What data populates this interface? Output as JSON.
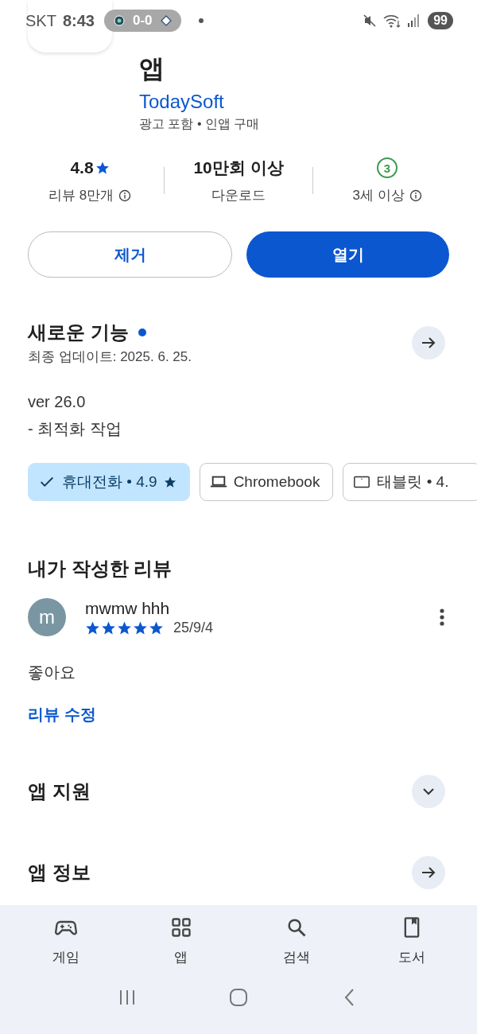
{
  "status_bar": {
    "carrier": "SKT",
    "time": "8:43",
    "score": "0-0",
    "battery": "99"
  },
  "app": {
    "title_line": "앱",
    "developer": "TodaySoft",
    "notes": "광고 포함 • 인앱 구매"
  },
  "stats": [
    {
      "kind": "rating",
      "value": "4.8",
      "label": "리뷰 8만개",
      "info": true
    },
    {
      "kind": "text",
      "value": "10만회 이상",
      "label": "다운로드",
      "info": false
    },
    {
      "kind": "age",
      "value": "3",
      "label": "3세 이상",
      "info": true
    }
  ],
  "actions": [
    {
      "label": "제거",
      "kind": "outline"
    },
    {
      "label": "열기",
      "kind": "filled"
    }
  ],
  "whats_new": {
    "title": "새로운 기능",
    "new_dot": true,
    "updated": "최종 업데이트: 2025. 6. 25.",
    "lines": [
      "ver 26.0",
      "- 최적화 작업"
    ]
  },
  "devices": [
    {
      "label": "휴대전화 • 4.9",
      "star": true,
      "selected": true
    },
    {
      "label": "Chromebook",
      "kind": "chromebook",
      "star": false,
      "selected": false
    },
    {
      "label": "태블릿 • 4.",
      "kind": "tablet",
      "star": false,
      "selected": false
    }
  ],
  "review": {
    "title": "내가 작성한 리뷰",
    "avatar": "m",
    "author": "mwmw hhh",
    "stars": 5,
    "date": "25/9/4",
    "text": "좋아요",
    "edit": "리뷰 수정"
  },
  "sections": [
    {
      "title": "앱 지원",
      "kind": "expand"
    },
    {
      "title": "앱 정보",
      "kind": "arrow"
    }
  ],
  "nav": [
    {
      "label": "게임",
      "selected": false
    },
    {
      "label": "앱",
      "selected": false
    },
    {
      "label": "검색",
      "selected": false
    },
    {
      "label": "도서",
      "selected": false
    }
  ]
}
